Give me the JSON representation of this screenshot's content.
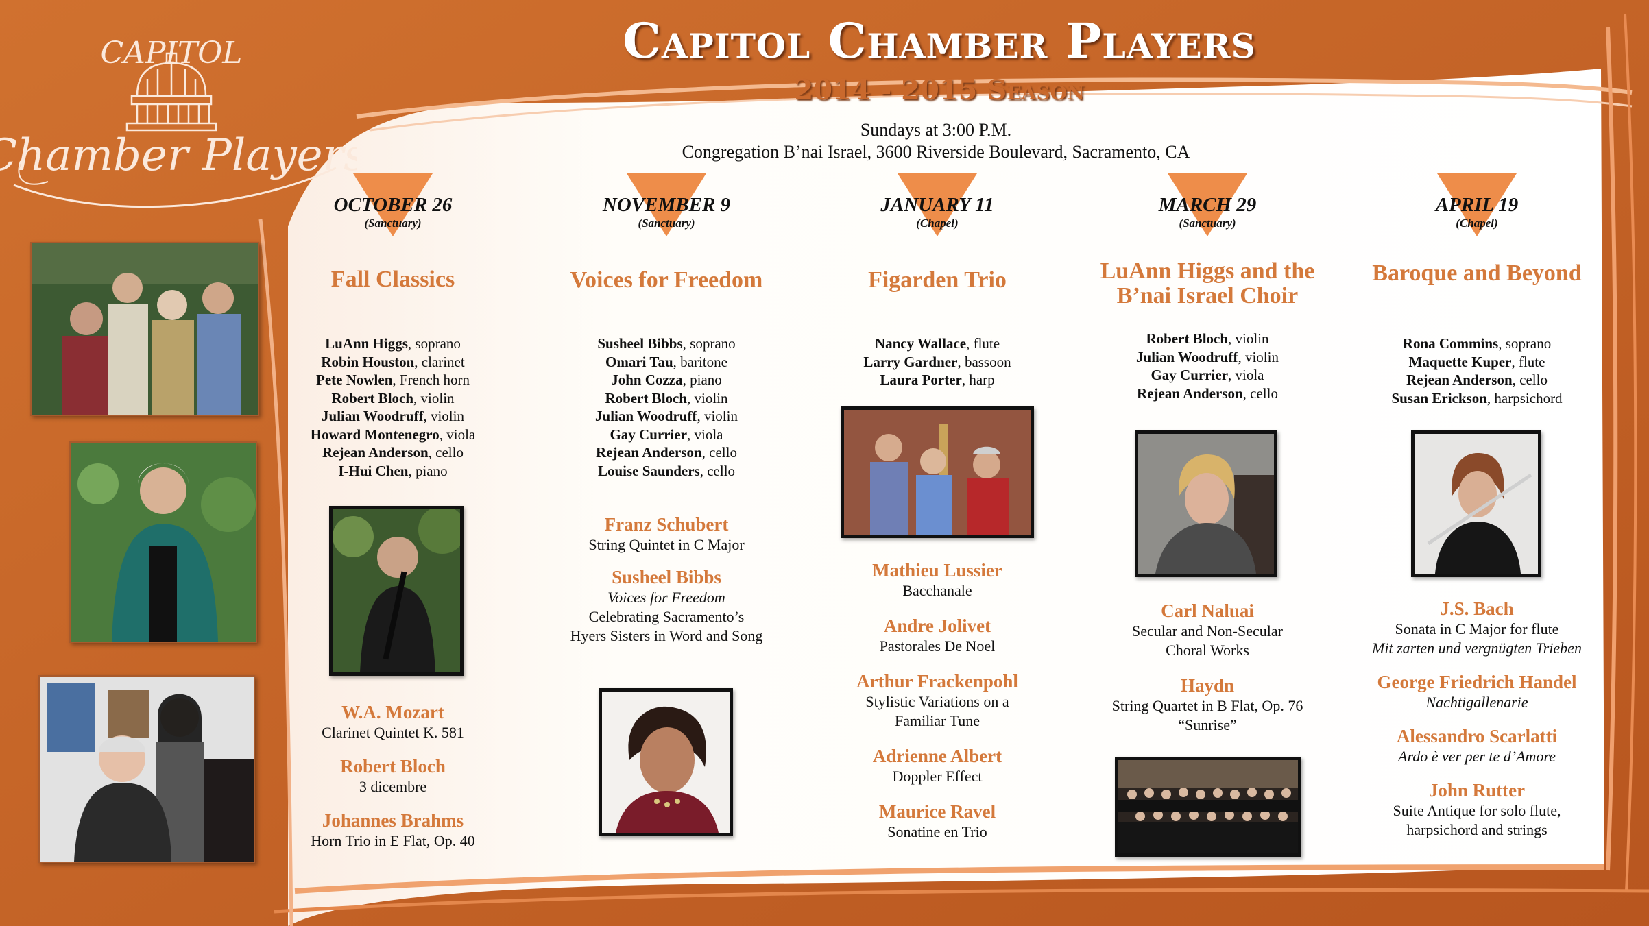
{
  "title": "Capitol Chamber Players",
  "season": "2014 - 2015 Season",
  "when": "Sundays at 3:00 P.M.",
  "where": "Congregation B’nai Israel, 3600 Riverside Boulevard, Sacramento, CA",
  "logo": {
    "top": "CAPITOL",
    "bottom": "Chamber Players"
  },
  "colors": {
    "orange": "#c9672e",
    "accent": "#d4793b",
    "triangle": "#ee8d4a",
    "cream": "#fffdf9"
  },
  "concerts": [
    {
      "date": "OCTOBER 26",
      "venue": "(Sanctuary)",
      "title_lines": [
        "Fall Classics"
      ],
      "performers": [
        {
          "name": "LuAnn Higgs",
          "role": "soprano"
        },
        {
          "name": "Robin Houston",
          "role": "clarinet"
        },
        {
          "name": "Pete Nowlen",
          "role": "French horn"
        },
        {
          "name": "Robert Bloch",
          "role": "violin"
        },
        {
          "name": "Julian Woodruff",
          "role": "violin"
        },
        {
          "name": "Howard Montenegro",
          "role": "viola"
        },
        {
          "name": "Rejean Anderson",
          "role": "cello"
        },
        {
          "name": "I-Hui Chen",
          "role": "piano"
        }
      ],
      "program": [
        {
          "composer": "W.A. Mozart",
          "works": [
            "Clarinet Quintet K. 581"
          ],
          "italic": false
        },
        {
          "composer": "Robert Bloch",
          "works": [
            "3 dicembre"
          ],
          "italic": false
        },
        {
          "composer": "Johannes Brahms",
          "works": [
            "Horn Trio in E Flat, Op. 40"
          ],
          "italic": false
        }
      ]
    },
    {
      "date": "NOVEMBER 9",
      "venue": "(Sanctuary)",
      "title_lines": [
        "Voices for Freedom"
      ],
      "performers": [
        {
          "name": "Susheel Bibbs",
          "role": "soprano"
        },
        {
          "name": "Omari Tau",
          "role": "baritone"
        },
        {
          "name": "John Cozza",
          "role": "piano"
        },
        {
          "name": "Robert Bloch",
          "role": "violin"
        },
        {
          "name": "Julian Woodruff",
          "role": "violin"
        },
        {
          "name": "Gay Currier",
          "role": "viola"
        },
        {
          "name": "Rejean Anderson",
          "role": "cello"
        },
        {
          "name": "Louise Saunders",
          "role": "cello"
        }
      ],
      "program": [
        {
          "composer": "Franz Schubert",
          "works": [
            "String Quintet in C Major"
          ],
          "italic": false
        },
        {
          "composer": "Susheel Bibbs",
          "works": [
            "Voices for Freedom",
            "Celebrating Sacramento’s",
            "Hyers Sisters in Word and Song"
          ],
          "italic_first": true
        }
      ]
    },
    {
      "date": "JANUARY 11",
      "venue": "(Chapel)",
      "title_lines": [
        "Figarden Trio"
      ],
      "performers": [
        {
          "name": "Nancy Wallace",
          "role": "flute"
        },
        {
          "name": "Larry Gardner",
          "role": "bassoon"
        },
        {
          "name": "Laura Porter",
          "role": "harp"
        }
      ],
      "program": [
        {
          "composer": "Mathieu Lussier",
          "works": [
            "Bacchanale"
          ],
          "italic": false
        },
        {
          "composer": "Andre Jolivet",
          "works": [
            "Pastorales De Noel"
          ],
          "italic": false
        },
        {
          "composer": "Arthur Frackenpohl",
          "works": [
            "Stylistic Variations on a",
            "Familiar Tune"
          ],
          "italic": false
        },
        {
          "composer": "Adrienne Albert",
          "works": [
            "Doppler Effect"
          ],
          "italic": false
        },
        {
          "composer": "Maurice Ravel",
          "works": [
            "Sonatine en Trio"
          ],
          "italic": false
        }
      ]
    },
    {
      "date": "MARCH 29",
      "venue": "(Sanctuary)",
      "title_lines": [
        "LuAnn Higgs and the",
        "B’nai Israel Choir"
      ],
      "performers": [
        {
          "name": "Robert Bloch",
          "role": "violin"
        },
        {
          "name": "Julian Woodruff",
          "role": "violin"
        },
        {
          "name": "Gay Currier",
          "role": "viola"
        },
        {
          "name": "Rejean Anderson",
          "role": "cello"
        }
      ],
      "program": [
        {
          "composer": "Carl Naluai",
          "works": [
            "Secular and Non-Secular",
            "Choral Works"
          ],
          "italic": false
        },
        {
          "composer": "Haydn",
          "works": [
            "String Quartet in B Flat, Op. 76",
            "“Sunrise”"
          ],
          "italic": false
        }
      ]
    },
    {
      "date": "APRIL 19",
      "venue": "(Chapel)",
      "title_lines": [
        "Baroque and Beyond"
      ],
      "performers": [
        {
          "name": "Rona Commins",
          "role": "soprano"
        },
        {
          "name": "Maquette Kuper",
          "role": "flute"
        },
        {
          "name": "Rejean Anderson",
          "role": "cello"
        },
        {
          "name": "Susan Erickson",
          "role": "harpsichord"
        }
      ],
      "program": [
        {
          "composer": "J.S. Bach",
          "works": [
            "Sonata in C Major for flute",
            "Mit zarten und vergnügten Trieben"
          ],
          "italic_second": true
        },
        {
          "composer": "George Friedrich Handel",
          "works": [
            "Nachtigallenarie"
          ],
          "italic": true
        },
        {
          "composer": "Alessandro Scarlatti",
          "works": [
            "Ardo è ver per te d’Amore"
          ],
          "italic": true
        },
        {
          "composer": "John Rutter",
          "works": [
            "Suite Antique for solo flute,",
            "harpsichord and strings"
          ],
          "italic": false
        }
      ]
    }
  ]
}
